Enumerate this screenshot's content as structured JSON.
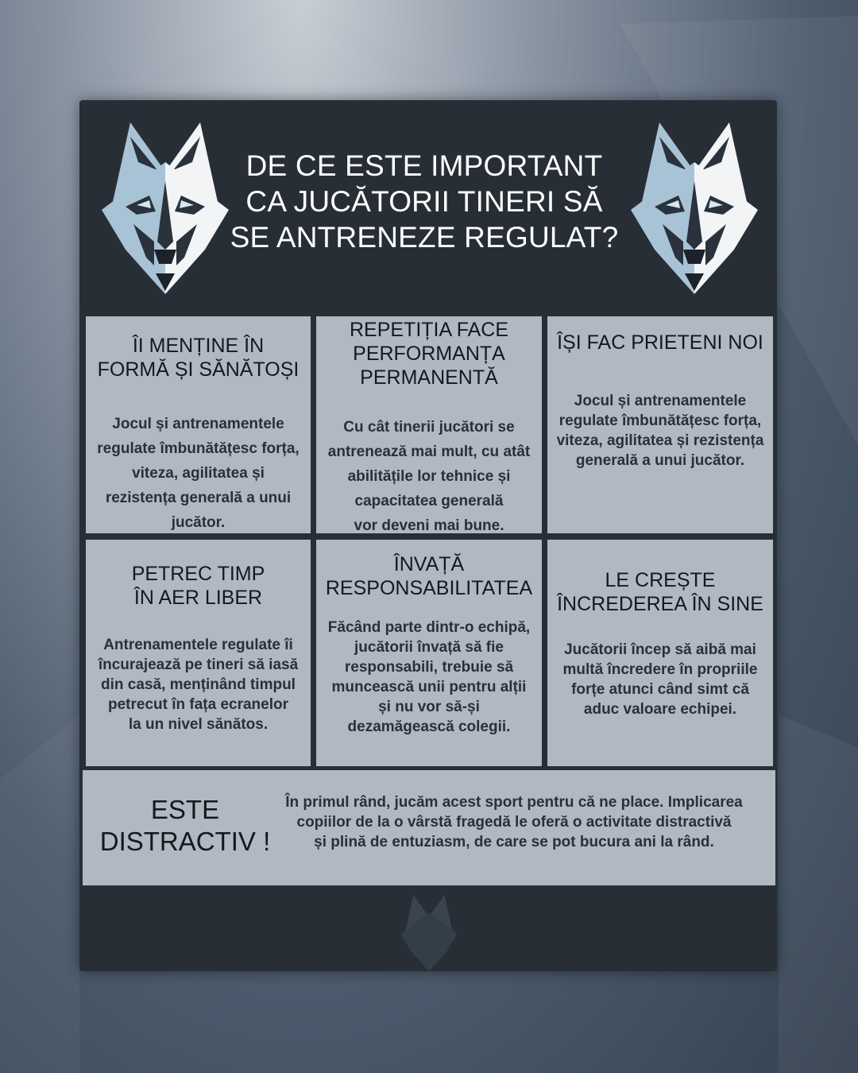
{
  "title": {
    "lines": [
      "DE CE ESTE IMPORTANT",
      "CA JUCĂTORII TINERI SĂ",
      "SE ANTRENEZE REGULAT?"
    ]
  },
  "cards": [
    {
      "title": [
        "ÎI MENȚINE ÎN",
        "FORMĂ ȘI SĂNĂTOȘI"
      ],
      "text": [
        "Jocul și antrenamentele",
        "regulate îmbunătățesc forța,",
        "viteza, agilitatea și",
        "rezistența generală a unui",
        "jucător."
      ]
    },
    {
      "title": [
        "REPETIȚIA FACE",
        "PERFORMANȚA",
        "PERMANENTĂ"
      ],
      "text": [
        "Cu cât tinerii jucători se",
        "antrenează mai mult, cu atât",
        "abilitățile lor tehnice și",
        "capacitatea generală",
        "vor deveni mai bune."
      ]
    },
    {
      "title": [
        "ÎȘI FAC PRIETENI NOI"
      ],
      "text": [
        "Jocul și antrenamentele",
        "regulate îmbunătățesc forța,",
        "viteza, agilitatea și rezistența",
        "generală a unui jucător."
      ]
    },
    {
      "title": [
        "PETREC TIMP",
        "ÎN AER LIBER"
      ],
      "text": [
        "Antrenamentele regulate îi",
        "încurajează pe tineri să iasă",
        "din casă, menținând timpul",
        "petrecut în fața ecranelor",
        "la un nivel sănătos."
      ]
    },
    {
      "title": [
        "ÎNVAȚĂ",
        "RESPONSABILITATEA"
      ],
      "text": [
        "Făcând parte dintr-o echipă,",
        "jucătorii învață să fie",
        "responsabili, trebuie să",
        "muncească unii pentru alții",
        "și nu vor să-și",
        "dezamăgească  colegii."
      ]
    },
    {
      "title": [
        "LE CREȘTE",
        "ÎNCREDEREA ÎN SINE"
      ],
      "text": [
        "Jucătorii încep să aibă mai",
        "multă încredere în propriile",
        "forțe atunci când simt că",
        "aduc valoare echipei."
      ]
    }
  ],
  "fun": {
    "title": [
      "ESTE",
      "DISTRACTIV !"
    ],
    "text": [
      "În primul rând, jucăm acest sport pentru că ne place. Implicarea",
      "copiilor de la o vârstă fragedă le oferă o activitate distractivă",
      "și plină de entuziasm, de care se pot bucura ani la rând."
    ]
  },
  "colors": {
    "panel": "#272e36",
    "card": "#c0c8d1",
    "wolf_light": "#a9c3d6",
    "wolf_white": "#f2f4f6",
    "wolf_dark": "#2a323b"
  },
  "icons": [
    "wolf-logo-icon",
    "wolf-logo-icon",
    "wolf-watermark-icon"
  ]
}
